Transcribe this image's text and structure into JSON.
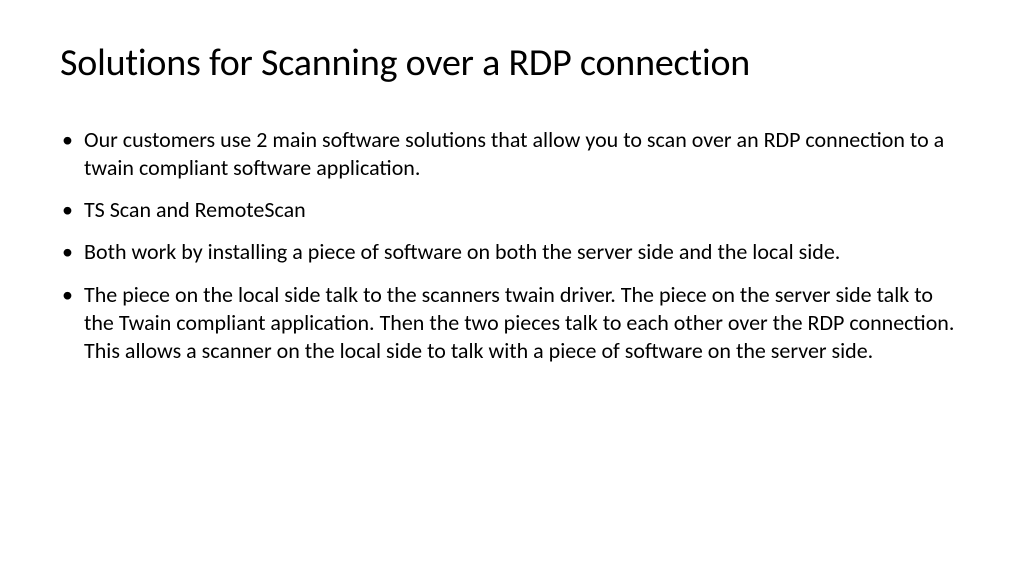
{
  "slide": {
    "title": "Solutions for Scanning over a RDP connection",
    "bullets": [
      "Our customers use 2 main software solutions that allow you to scan over an RDP connection to a twain compliant software application.",
      "TS Scan and RemoteScan",
      "Both work by installing a piece of software on both the server side and the local side.",
      "The piece on the local side talk to the scanners twain driver. The piece on the server side talk to the Twain compliant application. Then the two pieces talk to each other over the RDP connection. This allows a scanner on the local side to talk with a piece of software on the server side."
    ]
  }
}
